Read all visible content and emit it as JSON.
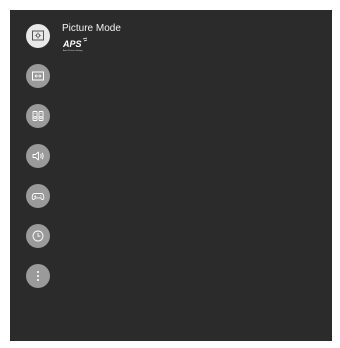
{
  "menu": {
    "items": [
      {
        "icon": "picture-icon",
        "label": "Picture Mode",
        "active": true
      },
      {
        "icon": "screen-icon"
      },
      {
        "icon": "speaker-icon"
      },
      {
        "icon": "volume-icon"
      },
      {
        "icon": "gamepad-icon"
      },
      {
        "icon": "clock-icon"
      },
      {
        "icon": "more-icon"
      }
    ],
    "badge": {
      "logo": "APS",
      "subtitle": "Auto Picture Setting"
    }
  },
  "colors": {
    "panel_bg": "#2b2b2b",
    "active_button": "#e8e8e8",
    "inactive_button": "#9a9a9a",
    "text": "#f2f2f2"
  }
}
